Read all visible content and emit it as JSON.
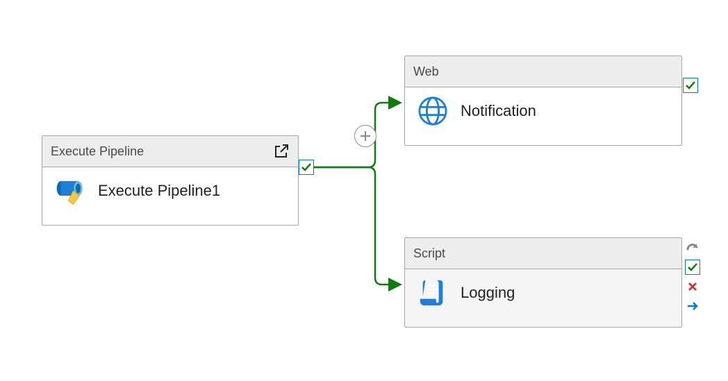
{
  "activities": {
    "execute_pipeline": {
      "type_label": "Execute Pipeline",
      "name": "Execute Pipeline1"
    },
    "web": {
      "type_label": "Web",
      "name": "Notification"
    },
    "script": {
      "type_label": "Script",
      "name": "Logging"
    }
  },
  "colors": {
    "connector_success": "#107c10",
    "header_bg": "#ededed",
    "border": "#a6a6a6",
    "icon_blue": "#1f7fd4",
    "icon_yellow": "#f2c94c",
    "fail_red": "#d13438",
    "arrow_blue": "#0078d4"
  }
}
